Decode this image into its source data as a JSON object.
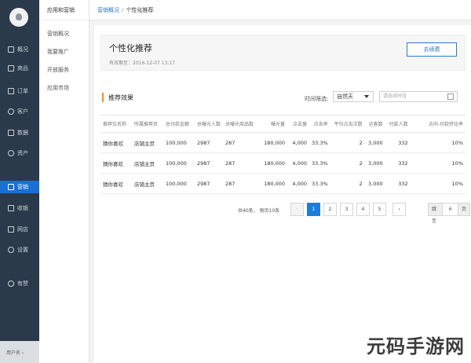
{
  "nav": {
    "items": [
      {
        "label": "概况",
        "icon": "monitor-icon"
      },
      {
        "label": "商品",
        "icon": "tag-icon"
      },
      {
        "label": "订单",
        "icon": "list-icon"
      },
      {
        "label": "客户",
        "icon": "user-icon"
      },
      {
        "label": "数据",
        "icon": "chart-icon"
      },
      {
        "label": "资产",
        "icon": "coin-icon"
      },
      {
        "label": "营销",
        "icon": "grid-icon"
      },
      {
        "label": "收银",
        "icon": "cashier-icon"
      },
      {
        "label": "网店",
        "icon": "shop-icon"
      },
      {
        "label": "设置",
        "icon": "gear-icon"
      },
      {
        "label": "有赞",
        "icon": "thumb-icon"
      }
    ],
    "user": "用户名 ›"
  },
  "subnav": {
    "header": "应用和营销",
    "items": [
      "营销概况",
      "我要推广",
      "开放服务",
      "应用市场"
    ]
  },
  "breadcrumb": {
    "link": "营销概况",
    "sep": "/",
    "current": "个性化推荐"
  },
  "header": {
    "title": "个性化推荐",
    "meta": "有效期至：2016-12-07 13:17",
    "button": "去续费"
  },
  "section": {
    "title": "推荐效果",
    "filter_label": "时间筛选:",
    "filter_value": "自然天",
    "date_placeholder": "请选择时段"
  },
  "table": {
    "headers": [
      "推荐位名称",
      "所属推荐页",
      "总付款金额",
      "总曝光人数",
      "总曝光商品数",
      "曝光量",
      "点击量",
      "点击率",
      "平均点击次数",
      "访客数",
      "付款人数",
      "访问-付款转化率"
    ],
    "rows": [
      [
        "猜你喜欢",
        "店铺主页",
        "100,000",
        "2987",
        "287",
        "180,000",
        "4,000",
        "33.3%",
        "2",
        "3,000",
        "332",
        "10%"
      ],
      [
        "猜你喜欢",
        "店铺主页",
        "100,000",
        "2987",
        "287",
        "180,000",
        "4,000",
        "33.3%",
        "2",
        "3,000",
        "332",
        "10%"
      ],
      [
        "猜你喜欢",
        "店铺主页",
        "100,000",
        "2987",
        "287",
        "180,000",
        "4,000",
        "33.3%",
        "2",
        "3,000",
        "332",
        "10%"
      ]
    ]
  },
  "pager": {
    "info": "共40条，  每页10条",
    "prev": "‹",
    "pages": [
      "1",
      "2",
      "3",
      "4",
      "5"
    ],
    "next": "›",
    "jump_label": "跳至",
    "jump_value": "6",
    "jump_unit": "页"
  },
  "watermark": "元码手游网",
  "colors": {
    "nav_bg": "#2b3a4a",
    "accent": "#1a7fd8",
    "section_marker": "#f08d1f"
  }
}
